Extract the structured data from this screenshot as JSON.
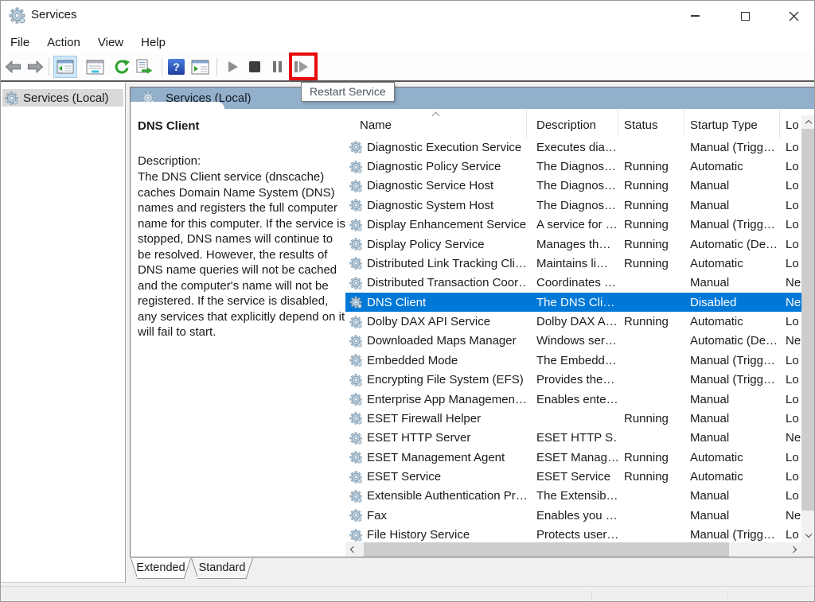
{
  "window": {
    "title": "Services"
  },
  "menu": {
    "items": [
      "File",
      "Action",
      "View",
      "Help"
    ]
  },
  "toolbar": {
    "tooltip": "Restart Service",
    "icons": [
      "back-arrow-icon",
      "forward-arrow-icon",
      "show-console-tree-icon",
      "properties-icon",
      "refresh-icon",
      "export-list-icon",
      "help-icon",
      "show-action-pane-icon",
      "start-service-icon",
      "stop-service-icon",
      "pause-service-icon",
      "restart-service-icon"
    ],
    "highlighted_button": "restart-service"
  },
  "tree": {
    "root_label": "Services (Local)"
  },
  "panel": {
    "header_title": "Services (Local)",
    "selected_service": {
      "name": "DNS Client",
      "description_label": "Description:",
      "description": "The DNS Client service (dnscache) caches Domain Name System (DNS) names and registers the full computer name for this computer. If the service is stopped, DNS names will continue to be resolved. However, the results of DNS name queries will not be cached and the computer's name will not be registered. If the service is disabled, any services that explicitly depend on it will fail to start."
    }
  },
  "services": {
    "columns": [
      "Name",
      "Description",
      "Status",
      "Startup Type",
      "Lo"
    ],
    "sort": {
      "column": "Name",
      "direction": "ascending"
    },
    "rows": [
      {
        "name": "Diagnostic Execution Service",
        "description": "Executes dia…",
        "status": "",
        "startup": "Manual (Trigg…",
        "logon": "Lo",
        "selected": false
      },
      {
        "name": "Diagnostic Policy Service",
        "description": "The Diagnos…",
        "status": "Running",
        "startup": "Automatic",
        "logon": "Lo",
        "selected": false
      },
      {
        "name": "Diagnostic Service Host",
        "description": "The Diagnos…",
        "status": "Running",
        "startup": "Manual",
        "logon": "Lo",
        "selected": false
      },
      {
        "name": "Diagnostic System Host",
        "description": "The Diagnos…",
        "status": "Running",
        "startup": "Manual",
        "logon": "Lo",
        "selected": false
      },
      {
        "name": "Display Enhancement Service",
        "description": "A service for …",
        "status": "Running",
        "startup": "Manual (Trigg…",
        "logon": "Lo",
        "selected": false
      },
      {
        "name": "Display Policy Service",
        "description": "Manages th…",
        "status": "Running",
        "startup": "Automatic (De…",
        "logon": "Lo",
        "selected": false
      },
      {
        "name": "Distributed Link Tracking Cli…",
        "description": "Maintains li…",
        "status": "Running",
        "startup": "Automatic",
        "logon": "Lo",
        "selected": false
      },
      {
        "name": "Distributed Transaction Coor…",
        "description": "Coordinates …",
        "status": "",
        "startup": "Manual",
        "logon": "Ne",
        "selected": false
      },
      {
        "name": "DNS Client",
        "description": "The DNS Cli…",
        "status": "",
        "startup": "Disabled",
        "logon": "Ne",
        "selected": true
      },
      {
        "name": "Dolby DAX API Service",
        "description": "Dolby DAX A…",
        "status": "Running",
        "startup": "Automatic",
        "logon": "Lo",
        "selected": false
      },
      {
        "name": "Downloaded Maps Manager",
        "description": "Windows ser…",
        "status": "",
        "startup": "Automatic (De…",
        "logon": "Ne",
        "selected": false
      },
      {
        "name": "Embedded Mode",
        "description": "The Embedd…",
        "status": "",
        "startup": "Manual (Trigg…",
        "logon": "Lo",
        "selected": false
      },
      {
        "name": "Encrypting File System (EFS)",
        "description": "Provides the…",
        "status": "",
        "startup": "Manual (Trigg…",
        "logon": "Lo",
        "selected": false
      },
      {
        "name": "Enterprise App Managemen…",
        "description": "Enables ente…",
        "status": "",
        "startup": "Manual",
        "logon": "Lo",
        "selected": false
      },
      {
        "name": "ESET Firewall Helper",
        "description": "",
        "status": "Running",
        "startup": "Manual",
        "logon": "Lo",
        "selected": false
      },
      {
        "name": "ESET HTTP Server",
        "description": "ESET HTTP S…",
        "status": "",
        "startup": "Manual",
        "logon": "Ne",
        "selected": false
      },
      {
        "name": "ESET Management Agent",
        "description": "ESET Manag…",
        "status": "Running",
        "startup": "Automatic",
        "logon": "Lo",
        "selected": false
      },
      {
        "name": "ESET Service",
        "description": "ESET Service",
        "status": "Running",
        "startup": "Automatic",
        "logon": "Lo",
        "selected": false
      },
      {
        "name": "Extensible Authentication Pr…",
        "description": "The Extensib…",
        "status": "",
        "startup": "Manual",
        "logon": "Lo",
        "selected": false
      },
      {
        "name": "Fax",
        "description": "Enables you …",
        "status": "",
        "startup": "Manual",
        "logon": "Ne",
        "selected": false
      },
      {
        "name": "File History Service",
        "description": "Protects user…",
        "status": "",
        "startup": "Manual (Trigg…",
        "logon": "Lo",
        "selected": false
      }
    ]
  },
  "tabs": {
    "items": [
      "Extended",
      "Standard"
    ],
    "active": "Extended"
  },
  "colors": {
    "selection": "#0078d7",
    "header_bar": "#92b0cc",
    "highlight_red": "#e60c0c",
    "selected_tree_item": "#d9d9d9"
  }
}
